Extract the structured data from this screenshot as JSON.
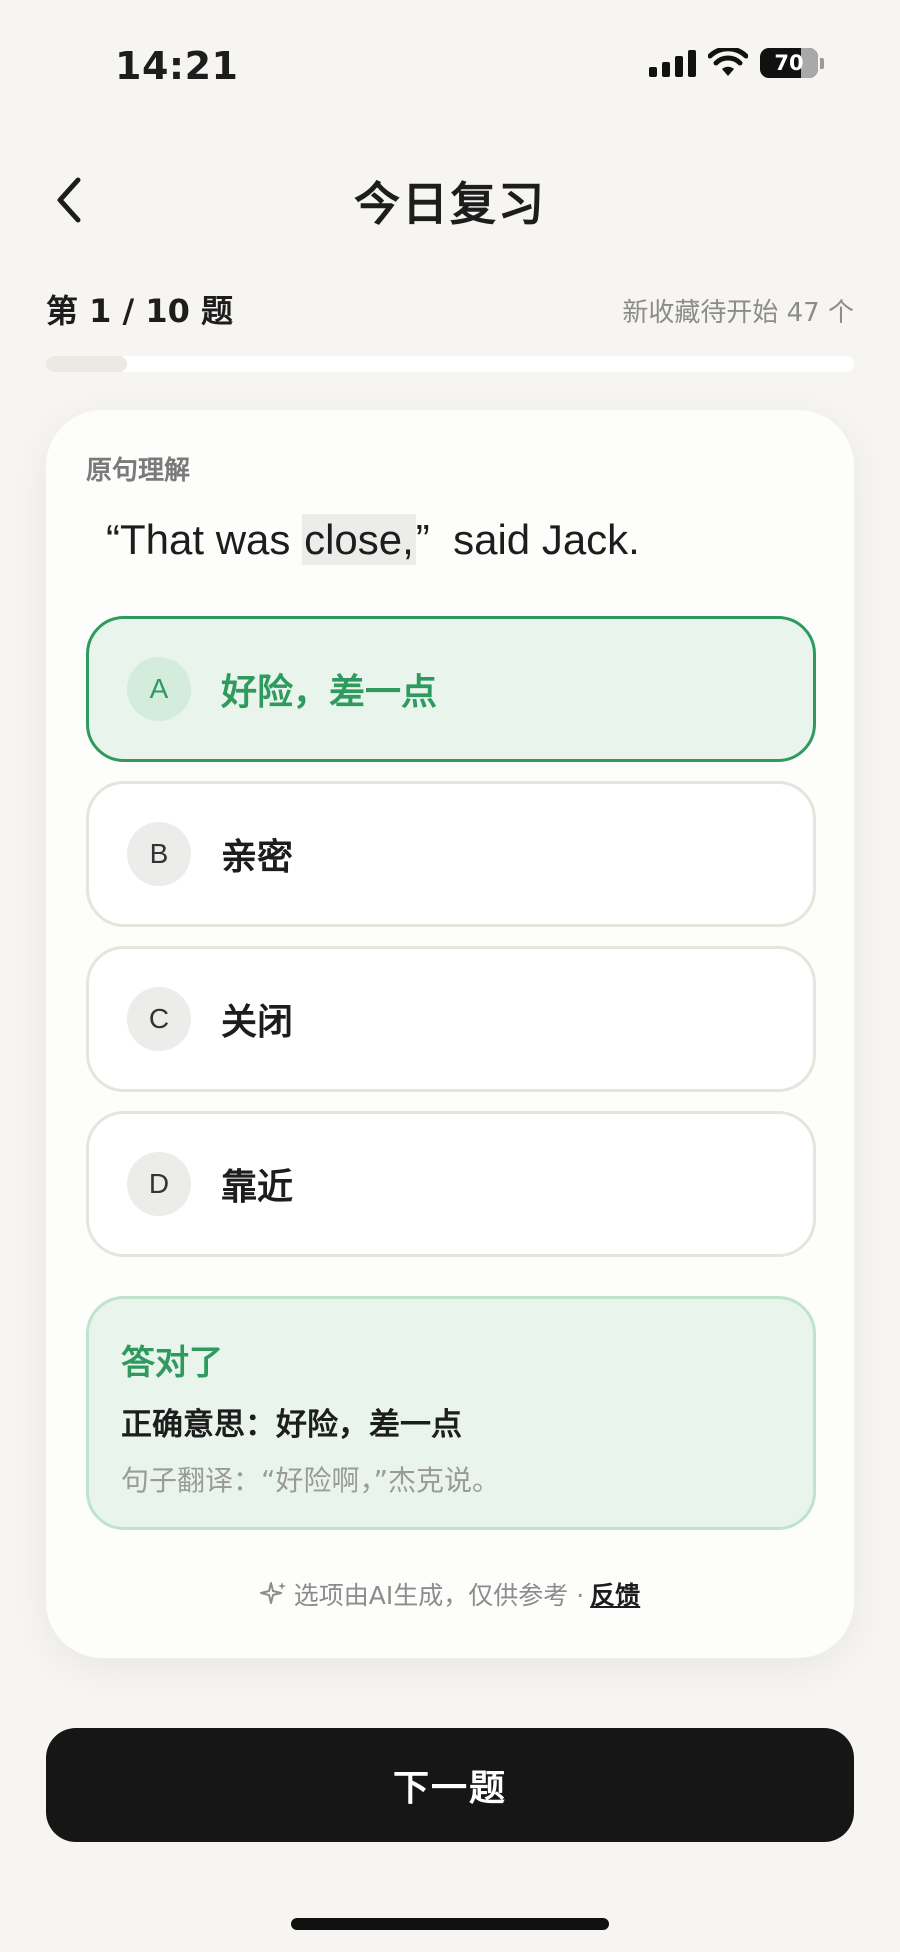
{
  "status_bar": {
    "time": "14:21",
    "battery": "70",
    "battery_level": 0.7
  },
  "header": {
    "title": "今日复习",
    "back_icon": "chevron-left-icon"
  },
  "progress": {
    "label": "第 1 / 10 题",
    "pending": "新收藏待开始 47 个",
    "fraction": 0.1
  },
  "card": {
    "section_label": "原句理解",
    "sentence": {
      "before": "“That was ",
      "highlight": "close,",
      "after": "”  said Jack."
    },
    "options": [
      {
        "letter": "A",
        "text": "好险，差一点",
        "state": "correct"
      },
      {
        "letter": "B",
        "text": "亲密",
        "state": "default"
      },
      {
        "letter": "C",
        "text": "关闭",
        "state": "default"
      },
      {
        "letter": "D",
        "text": "靠近",
        "state": "default"
      }
    ],
    "result": {
      "title": "答对了",
      "meaning": "正确意思：好险，差一点",
      "translation": "句子翻译：“好险啊，”杰克说。"
    },
    "ai_note": {
      "text": "选项由AI生成，仅供参考 ·",
      "link": "反馈",
      "icon": "sparkle-icon"
    }
  },
  "next_button": {
    "label": "下一题"
  },
  "colors": {
    "accent": "#2f9a5e",
    "background": "#f7f5f2",
    "button": "#161616"
  }
}
